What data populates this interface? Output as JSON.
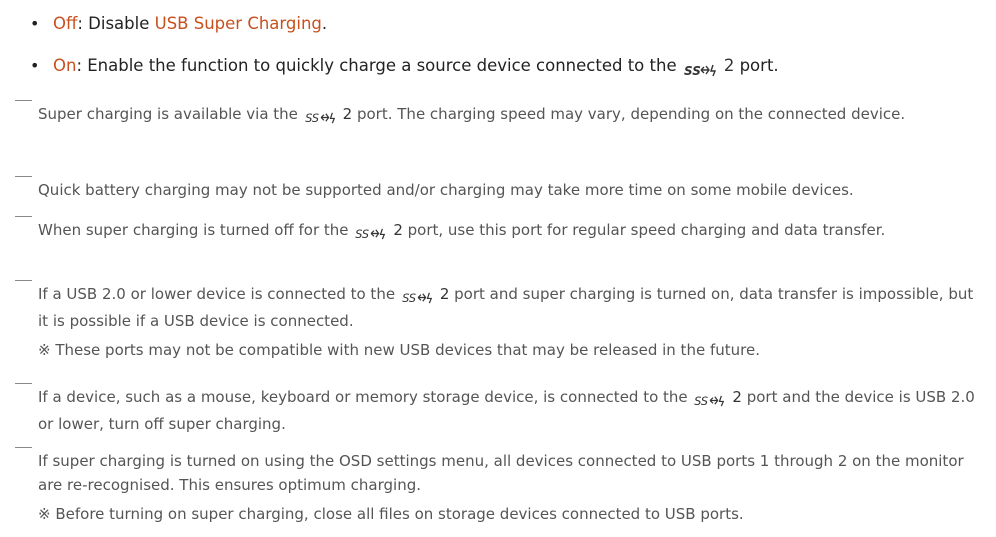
{
  "bullets": [
    {
      "dot": "•",
      "term": "Off",
      "sep": ": Disable ",
      "link": "USB Super Charging",
      "end": "."
    },
    {
      "dot": "•",
      "term": "On",
      "text": ": Enable the function to quickly charge a source device connected to the ",
      "port_icon": "ss-usb-charge-icon",
      "port_num": "2",
      "end": " port."
    }
  ],
  "notes": [
    {
      "before": "Super charging is available via the ",
      "port_num": "2",
      "after": " port. The charging speed may vary, depending on the connected device."
    },
    {
      "text": "Quick battery charging may not be supported and/or charging may take more time on some mobile devices."
    },
    {
      "before": "When super charging is turned off for the ",
      "port_num": "2",
      "after": " port, use this port for regular speed charging and data transfer."
    },
    {
      "before": "If a USB 2.0 or lower device is connected to the ",
      "port_num": "2",
      "after": " port and super charging is turned on, data transfer is impossible, but it is possible if a USB device is connected.",
      "sub": "※ These ports may not be compatible with new USB devices that may be released in the future."
    },
    {
      "before": "If a device, such as a mouse, keyboard or memory storage device, is connected to the ",
      "port_num": "2",
      "after": " port and the device is USB 2.0 or lower, turn off super charging."
    },
    {
      "text": "If super charging is turned on using the OSD settings menu, all devices connected to USB ports 1 through 2 on the monitor are re-recognised. This ensures optimum charging.",
      "sub": "※ Before turning on super charging, close all files on storage devices connected to USB ports."
    }
  ],
  "colors": {
    "accent": "#c8501e",
    "text": "#444444",
    "note_text": "#555555"
  }
}
